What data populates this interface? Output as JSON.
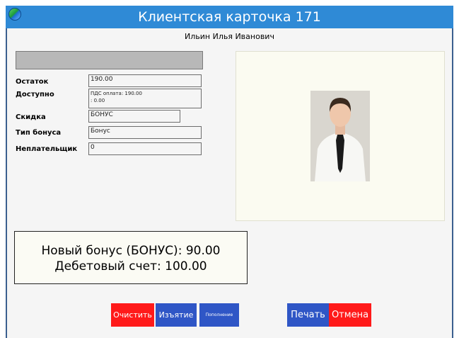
{
  "window": {
    "title": "Клиентская карточка 171"
  },
  "client": {
    "name": "Ильин Илья Иванович"
  },
  "fields": {
    "ostatok": {
      "label": "Остаток",
      "value": "190.00"
    },
    "dostupno": {
      "label": "Доступно",
      "value": "ПДС оплата: 190.00\n: 0.00"
    },
    "skidka": {
      "label": "Скидка",
      "value": "БОНУС"
    },
    "tip_bonusa": {
      "label": "Тип бонуса",
      "value": "Бонус"
    },
    "neplatelshchik": {
      "label": "Неплательщик",
      "value": "0"
    }
  },
  "summary": {
    "line1": "Новый бонус (БОНУС): 90.00",
    "line2": "Дебетовый счет: 100.00"
  },
  "buttons": {
    "clear": "Очистить",
    "withdraw": "Изъятие",
    "topup": "Пополнение",
    "print": "Печать",
    "cancel": "Отмена"
  },
  "colors": {
    "title_bar": "#2f8ad6",
    "danger_button": "#ff1a1a",
    "primary_button": "#2f56c6"
  }
}
